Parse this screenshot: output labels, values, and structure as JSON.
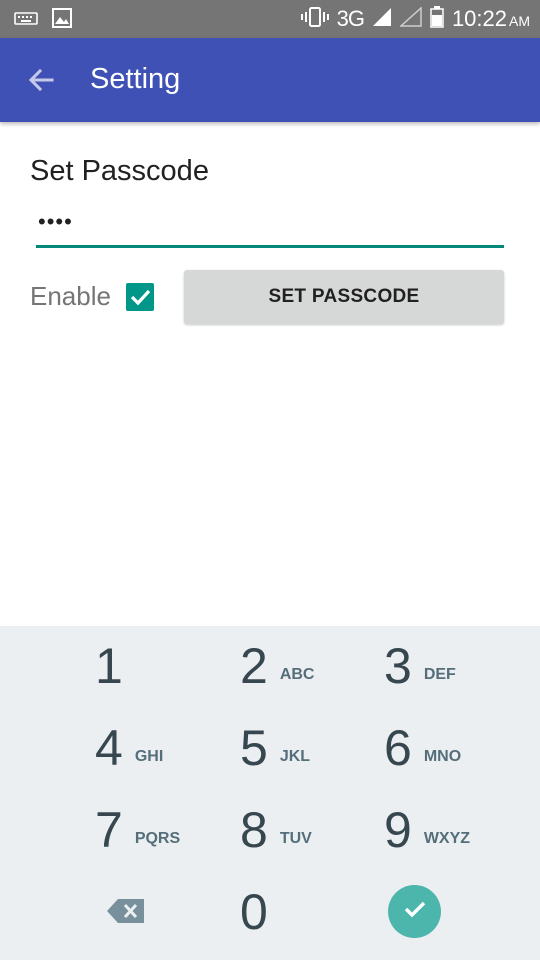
{
  "status_bar": {
    "network": "3G",
    "time": "10:22",
    "ampm": "AM"
  },
  "app_bar": {
    "title": "Setting"
  },
  "passcode": {
    "section_title": "Set Passcode",
    "masked_value": "••••",
    "enable_label": "Enable",
    "enable_checked": true,
    "set_button_label": "SET PASSCODE"
  },
  "keypad": {
    "keys": [
      {
        "digit": "1",
        "letters": ""
      },
      {
        "digit": "2",
        "letters": "ABC"
      },
      {
        "digit": "3",
        "letters": "DEF"
      },
      {
        "digit": "4",
        "letters": "GHI"
      },
      {
        "digit": "5",
        "letters": "JKL"
      },
      {
        "digit": "6",
        "letters": "MNO"
      },
      {
        "digit": "7",
        "letters": "PQRS"
      },
      {
        "digit": "8",
        "letters": "TUV"
      },
      {
        "digit": "9",
        "letters": "WXYZ"
      },
      {
        "digit": "0",
        "letters": ""
      }
    ]
  },
  "colors": {
    "app_bar": "#3f51b5",
    "status_bar": "#757575",
    "accent": "#009688",
    "keypad_bg": "#eceff1",
    "done_key": "#4db6ac"
  },
  "icons": [
    "keyboard-icon",
    "image-icon",
    "vibrate-icon",
    "signal-icon",
    "signal-empty-icon",
    "battery-icon",
    "back-arrow-icon",
    "checkmark-icon",
    "backspace-icon",
    "done-check-icon"
  ]
}
